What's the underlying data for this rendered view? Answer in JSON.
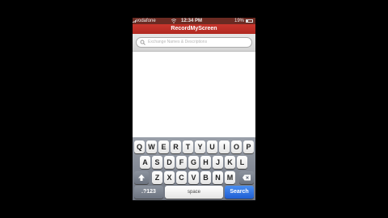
{
  "status_bar": {
    "carrier": "vodafone",
    "time": "12:34 PM",
    "battery": "19%"
  },
  "app_title": "RecordMyScreen",
  "search": {
    "placeholder": "Exchange Names & Descriptions"
  },
  "keyboard": {
    "row1": [
      "Q",
      "W",
      "E",
      "R",
      "T",
      "Y",
      "U",
      "I",
      "O",
      "P"
    ],
    "row2": [
      "A",
      "S",
      "D",
      "F",
      "G",
      "H",
      "J",
      "K",
      "L"
    ],
    "row3": [
      "Z",
      "X",
      "C",
      "V",
      "B",
      "N",
      "M"
    ],
    "numbers_label": ".?123",
    "space_label": "space",
    "search_label": "Search"
  },
  "colors": {
    "title_bar": "#c9362d",
    "search_key": "#1f5fd4"
  }
}
